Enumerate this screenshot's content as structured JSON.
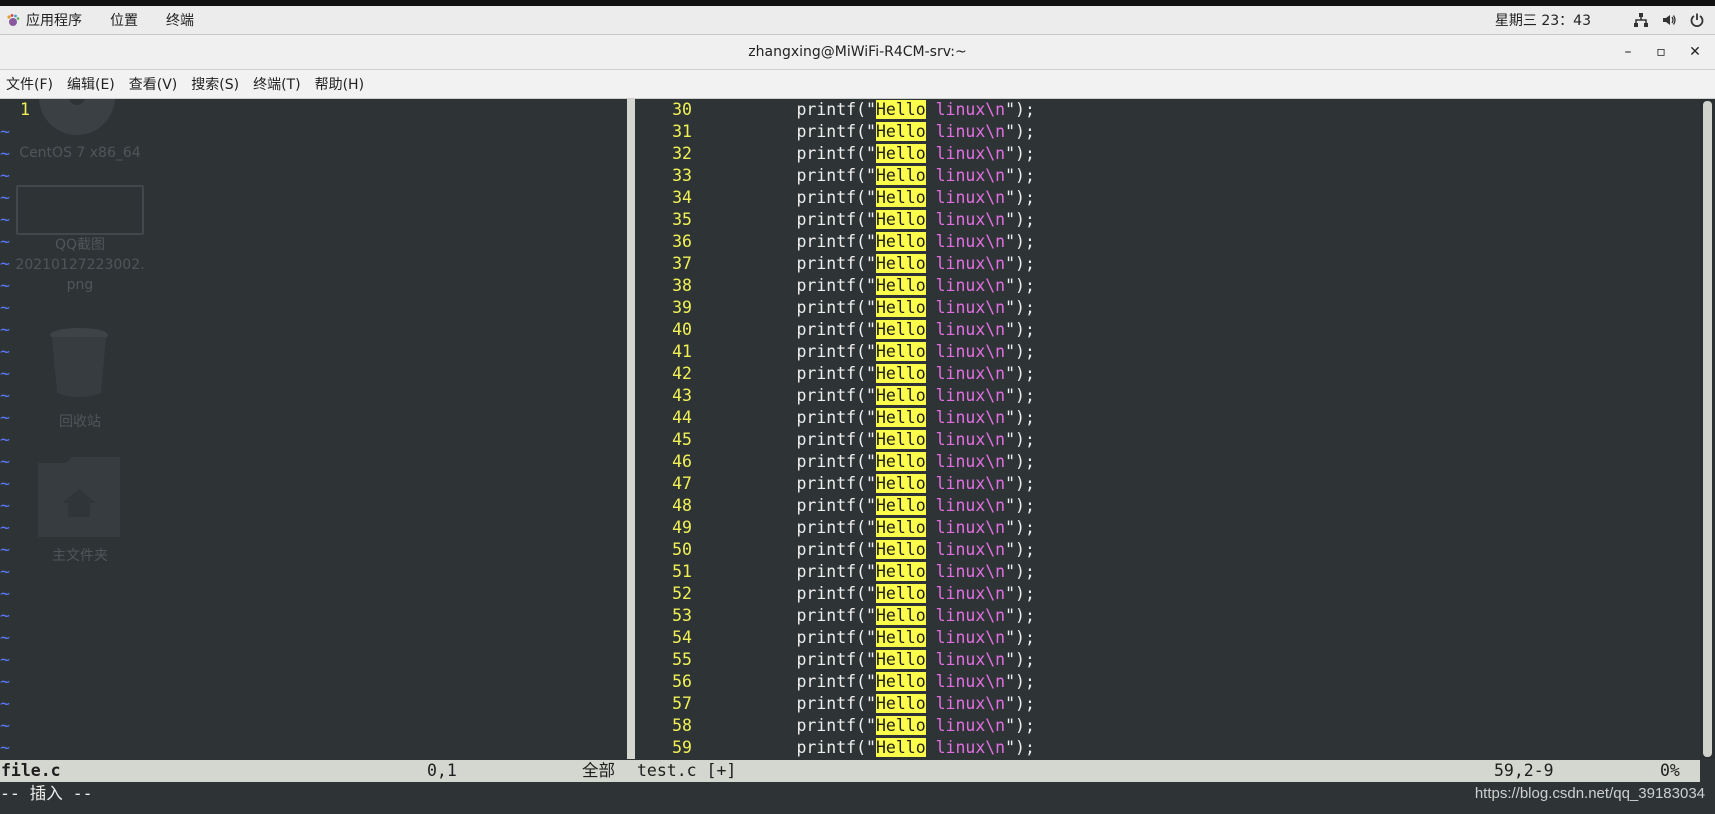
{
  "system_bar": {
    "applications_label": "应用程序",
    "places_label": "位置",
    "terminal_label": "终端",
    "clock": "星期三 23：43"
  },
  "window": {
    "title": "zhangxing@MiWiFi-R4CM-srv:~",
    "minimize": "–",
    "maximize": "▫",
    "close": "✕"
  },
  "menu": {
    "file": "文件(F)",
    "edit": "编辑(E)",
    "view": "查看(V)",
    "search": "搜索(S)",
    "terminal": "终端(T)",
    "help": "帮助(H)"
  },
  "desktop_icons": {
    "dvd_label": "CentOS 7 x86_64",
    "screenshot_label_1": "QQ截图",
    "screenshot_label_2": "20210127223002.",
    "screenshot_label_3": "png",
    "trash_label": "回收站",
    "home_label": "主文件夹"
  },
  "left_pane": {
    "line_number": "1",
    "empty_line_marker": "~"
  },
  "right_pane": {
    "indent": "        ",
    "func_text": "printf(",
    "quote_open": "\"",
    "hello_text": "Hello",
    "space": " ",
    "linux_text": "linux",
    "escape_text": "\\n",
    "tail_text": "\");",
    "line_numbers": [
      "30",
      "31",
      "32",
      "33",
      "34",
      "35",
      "36",
      "37",
      "38",
      "39",
      "40",
      "41",
      "42",
      "43",
      "44",
      "45",
      "46",
      "47",
      "48",
      "49",
      "50",
      "51",
      "52",
      "53",
      "54",
      "55",
      "56",
      "57",
      "58",
      "59"
    ]
  },
  "status": {
    "left_file": "file.c",
    "left_pos": "0,1",
    "left_all": "全部",
    "right_file": "test.c [+]",
    "right_pos": "59,2-9",
    "right_pct": "0%",
    "mode": "-- 插入 --"
  },
  "watermark": "https://blog.csdn.net/qq_39183034",
  "colors": {
    "terminal_bg": "#2e3436",
    "line_number": "#f1f156",
    "tilde": "#5a78ff",
    "highlight": "#fcfc4a",
    "magenta": "#e26fe2"
  }
}
